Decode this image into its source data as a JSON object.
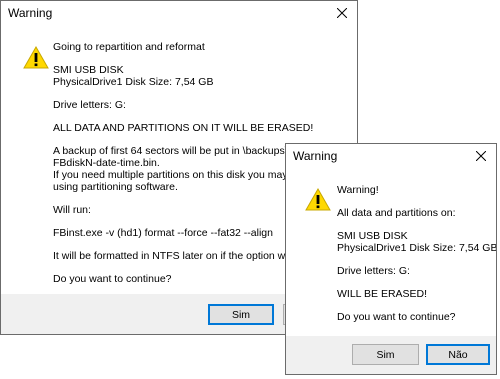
{
  "dialog_back": {
    "title": "Warning",
    "lines": [
      "Going to repartition and reformat",
      "SMI USB DISK",
      "PhysicalDrive1   Disk Size: 7,54 GB",
      "Drive letters:  G:",
      "ALL DATA AND PARTITIONS ON IT WILL BE ERASED!",
      "A backup of first 64 sectors will be put in \\backups\\ as",
      "FBdiskN-date-time.bin.",
      "If you need multiple partitions on this disk you may do that",
      "using partitioning software.",
      "Will run:",
      "FBinst.exe -v (hd1) format --force  --fat32 --align",
      "It will be formatted in NTFS later on if the option was select",
      "Do you want to continue?"
    ],
    "yes_label": "Sim",
    "no_label": ""
  },
  "dialog_front": {
    "title": "Warning",
    "lines": [
      "Warning!",
      "All data and partitions on:",
      "SMI USB DISK",
      "PhysicalDrive1   Disk Size: 7,54 GB",
      "Drive letters:  G:",
      " WILL BE ERASED!",
      "Do you want to continue?"
    ],
    "yes_label": "Sim",
    "no_label": "Não"
  },
  "colors": {
    "warning_yellow": "#ffd800",
    "footer_bg": "#f0f0f0",
    "default_button_border": "#0078d7"
  },
  "icons": [
    "warning-icon",
    "close-icon"
  ]
}
